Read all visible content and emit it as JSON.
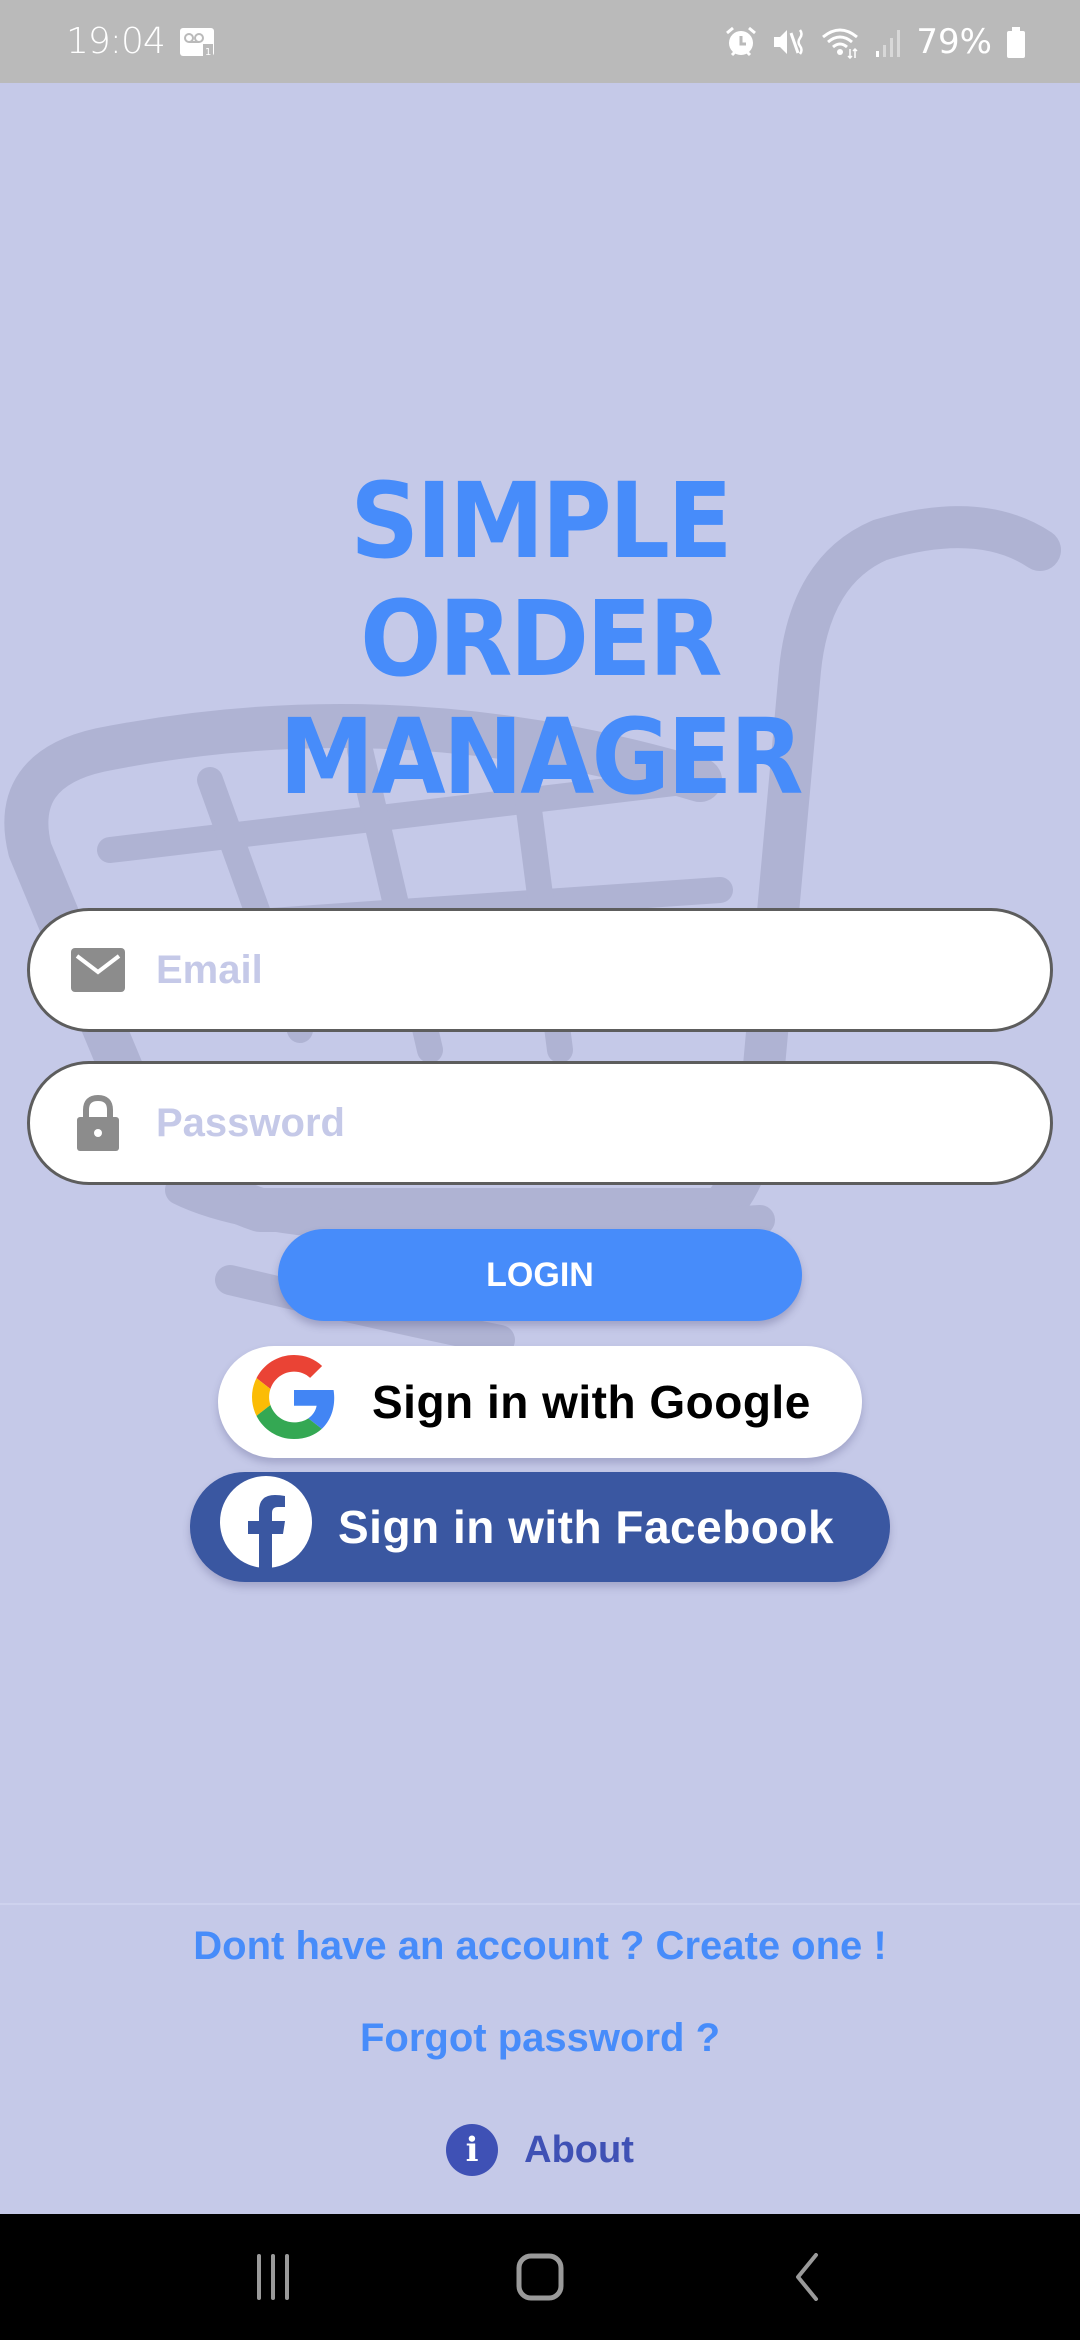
{
  "status_bar": {
    "time": "19:04",
    "battery_percent": "79%",
    "icons": [
      "voicemail-icon",
      "alarm-icon",
      "vibrate-mute-icon",
      "wifi-icon",
      "signal-icon",
      "battery-icon"
    ]
  },
  "app": {
    "title_lines": [
      "SIMPLE",
      "ORDER",
      "MANAGER"
    ],
    "background_icon": "shopping-cart-icon"
  },
  "form": {
    "email": {
      "placeholder": "Email",
      "value": "",
      "icon": "email-icon"
    },
    "password": {
      "placeholder": "Password",
      "value": "",
      "icon": "lock-icon"
    },
    "login_label": "LOGIN"
  },
  "social": {
    "google_label": "Sign in with Google",
    "facebook_label": "Sign in with Facebook"
  },
  "footer": {
    "create_account": "Dont have an account ? Create one !",
    "forgot_password": "Forgot password ?",
    "about": "About"
  },
  "nav_bar": {
    "buttons": [
      "recents-icon",
      "home-icon",
      "back-icon"
    ]
  },
  "colors": {
    "background": "#c5c9e8",
    "accent": "#478cfa",
    "facebook": "#3a57a1",
    "about": "#3f51b5"
  }
}
